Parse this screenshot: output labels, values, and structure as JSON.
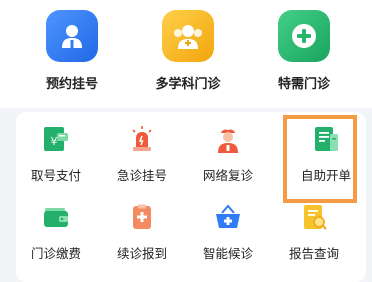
{
  "top_services": [
    {
      "label": "预约挂号",
      "icon": "doctor-icon",
      "color": "#2e7cf6"
    },
    {
      "label": "多学科门诊",
      "icon": "team-icon",
      "color": "#f6b61d"
    },
    {
      "label": "特需门诊",
      "icon": "plus-icon",
      "color": "#25b56f"
    }
  ],
  "grid_services": [
    {
      "label": "取号支付",
      "icon": "ticket-pay-icon"
    },
    {
      "label": "急诊挂号",
      "icon": "emergency-light-icon"
    },
    {
      "label": "网络复诊",
      "icon": "nurse-icon"
    },
    {
      "label": "自助开单",
      "icon": "order-form-icon"
    },
    {
      "label": "门诊缴费",
      "icon": "wallet-icon"
    },
    {
      "label": "续诊报到",
      "icon": "checkin-icon"
    },
    {
      "label": "智能候诊",
      "icon": "waiting-basket-icon"
    },
    {
      "label": "报告查询",
      "icon": "report-search-icon"
    }
  ],
  "highlighted_item": "自助开单",
  "colors": {
    "highlight": "#f59a45",
    "green": "#22b06b",
    "red": "#ee5a3b",
    "blue": "#2f7cf5",
    "yellow": "#f6b61d"
  }
}
